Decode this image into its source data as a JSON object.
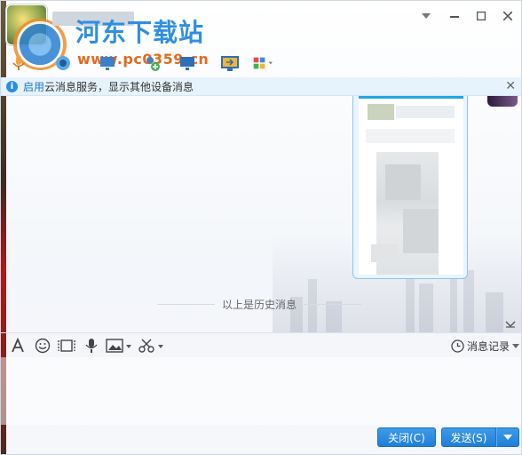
{
  "header": {
    "watermark_title": "河东下载站",
    "watermark_url": "www.pc0359.cn"
  },
  "window_controls": {
    "menu_icon": "chevron-down-icon",
    "minimize_icon": "minimize-icon",
    "maximize_icon": "maximize-icon",
    "close_icon": "close-icon"
  },
  "infobar": {
    "link": "启用",
    "text": "云消息服务，显示其他设备消息"
  },
  "chat": {
    "history_divider": "以上是历史消息"
  },
  "input_toolbar": {
    "history_label": "消息记录"
  },
  "buttons": {
    "close_label": "关闭(C)",
    "send_label": "发送(S)"
  },
  "colors": {
    "accent": "#2b8de4",
    "button": "#2a87dd",
    "infobar_bg": "#e6f2fc"
  }
}
